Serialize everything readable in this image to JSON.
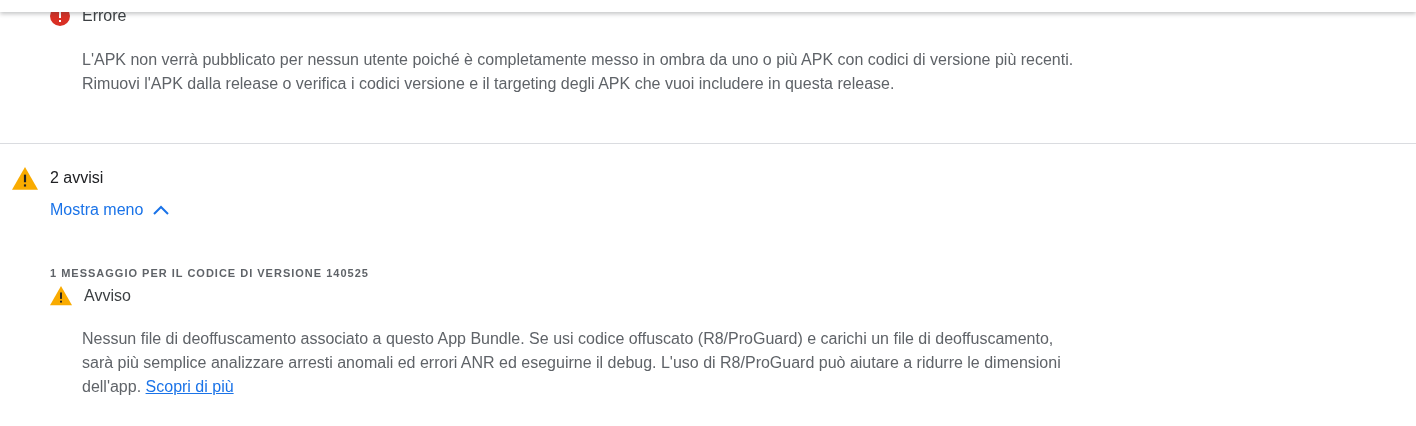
{
  "error": {
    "title": "Errore",
    "message": "L'APK non verrà pubblicato per nessun utente poiché è completamente messo in ombra da uno o più APK con codici di versione più recenti. Rimuovi l'APK dalla release o verifica i codici versione e il targeting degli APK che vuoi includere in questa release."
  },
  "warnings": {
    "title": "2 avvisi",
    "toggle": "Mostra meno",
    "expanded": true,
    "groups": [
      {
        "heading": "1 MESSAGGIO PER IL CODICE DI VERSIONE 140525",
        "items": [
          {
            "title": "Avviso",
            "message": "Nessun file di deoffuscamento associato a questo App Bundle. Se usi codice offuscato (R8/ProGuard) e carichi un file di deoffuscamento, sarà più semplice analizzare arresti anomali ed errori ANR ed eseguirne il debug. L'uso di R8/ProGuard può aiutare a ridurre le dimensioni dell'app.",
            "link": "Scopri di più"
          }
        ]
      }
    ]
  }
}
